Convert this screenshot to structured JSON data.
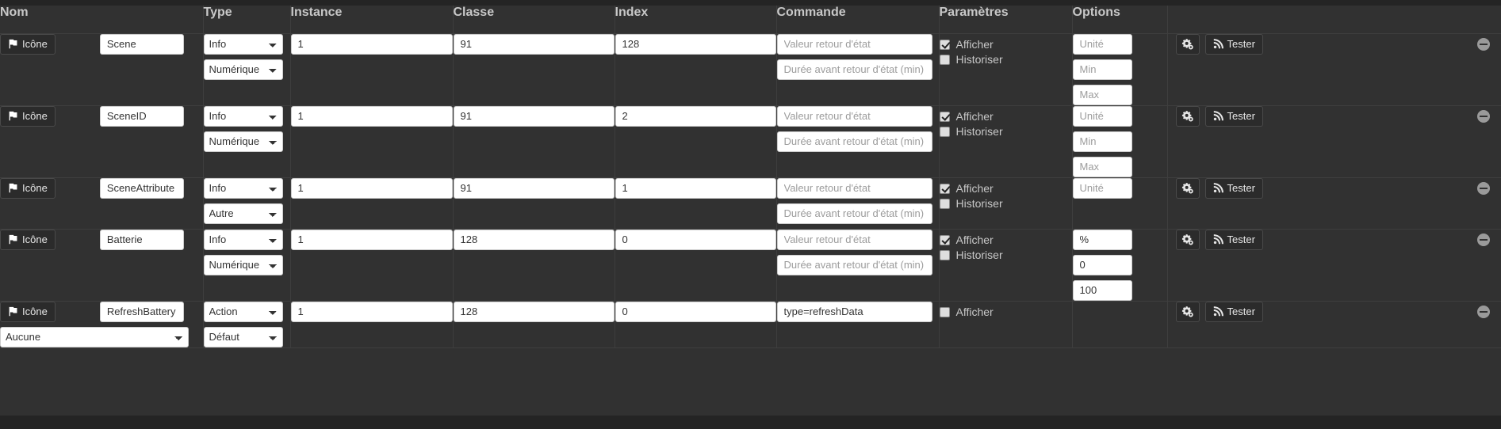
{
  "table": {
    "headers": [
      "Nom",
      "Type",
      "Instance",
      "Classe",
      "Index",
      "Commande",
      "Paramètres",
      "Options",
      ""
    ],
    "icon_button_label": "Icône",
    "test_button_label": "Tester",
    "param_labels": {
      "afficher": "Afficher",
      "historiser": "Historiser"
    },
    "placeholders": {
      "commande_value": "Valeur retour d'état",
      "commande_duration": "Durée avant retour d'état (min)",
      "unite": "Unité",
      "min": "Min",
      "max": "Max"
    },
    "icons": {
      "flag": "flag-icon",
      "gear": "gears-icon",
      "rss": "rss-icon",
      "remove": "remove-circle-icon"
    },
    "colors": {
      "background": "#313131",
      "border": "#3e3e3e",
      "header_text": "#c8c8c8",
      "input_bg": "#ffffff",
      "input_text": "#333333",
      "placeholder_text": "#9c9c9c",
      "button_bg": "#2b2b2b"
    },
    "rows": [
      {
        "name": "Scene",
        "name_select": null,
        "type": "Info",
        "subtype": "Numérique",
        "instance": "1",
        "classe": "91",
        "index": "128",
        "commande_value": "",
        "commande_duration": "",
        "show_duration": true,
        "afficher": true,
        "historiser": false,
        "show_historiser": true,
        "options": [
          {
            "field": "unite",
            "value": ""
          },
          {
            "field": "min",
            "value": ""
          },
          {
            "field": "max",
            "value": ""
          }
        ]
      },
      {
        "name": "SceneID",
        "name_select": null,
        "type": "Info",
        "subtype": "Numérique",
        "instance": "1",
        "classe": "91",
        "index": "2",
        "commande_value": "",
        "commande_duration": "",
        "show_duration": true,
        "afficher": true,
        "historiser": false,
        "show_historiser": true,
        "options": [
          {
            "field": "unite",
            "value": ""
          },
          {
            "field": "min",
            "value": ""
          },
          {
            "field": "max",
            "value": ""
          }
        ]
      },
      {
        "name": "SceneAttribute",
        "name_select": null,
        "type": "Info",
        "subtype": "Autre",
        "instance": "1",
        "classe": "91",
        "index": "1",
        "commande_value": "",
        "commande_duration": "",
        "show_duration": true,
        "afficher": true,
        "historiser": false,
        "show_historiser": true,
        "options": [
          {
            "field": "unite",
            "value": ""
          }
        ]
      },
      {
        "name": "Batterie",
        "name_select": null,
        "type": "Info",
        "subtype": "Numérique",
        "instance": "1",
        "classe": "128",
        "index": "0",
        "commande_value": "",
        "commande_duration": "",
        "show_duration": true,
        "afficher": true,
        "historiser": false,
        "show_historiser": true,
        "options": [
          {
            "field": "unite",
            "value": "%"
          },
          {
            "field": "min",
            "value": "0"
          },
          {
            "field": "max",
            "value": "100"
          }
        ]
      },
      {
        "name": "RefreshBattery",
        "name_select": "Aucune",
        "type": "Action",
        "subtype": "Défaut",
        "instance": "1",
        "classe": "128",
        "index": "0",
        "commande_value": "type=refreshData",
        "commande_duration": "",
        "show_duration": false,
        "afficher": false,
        "historiser": false,
        "show_historiser": false,
        "options": []
      }
    ]
  }
}
